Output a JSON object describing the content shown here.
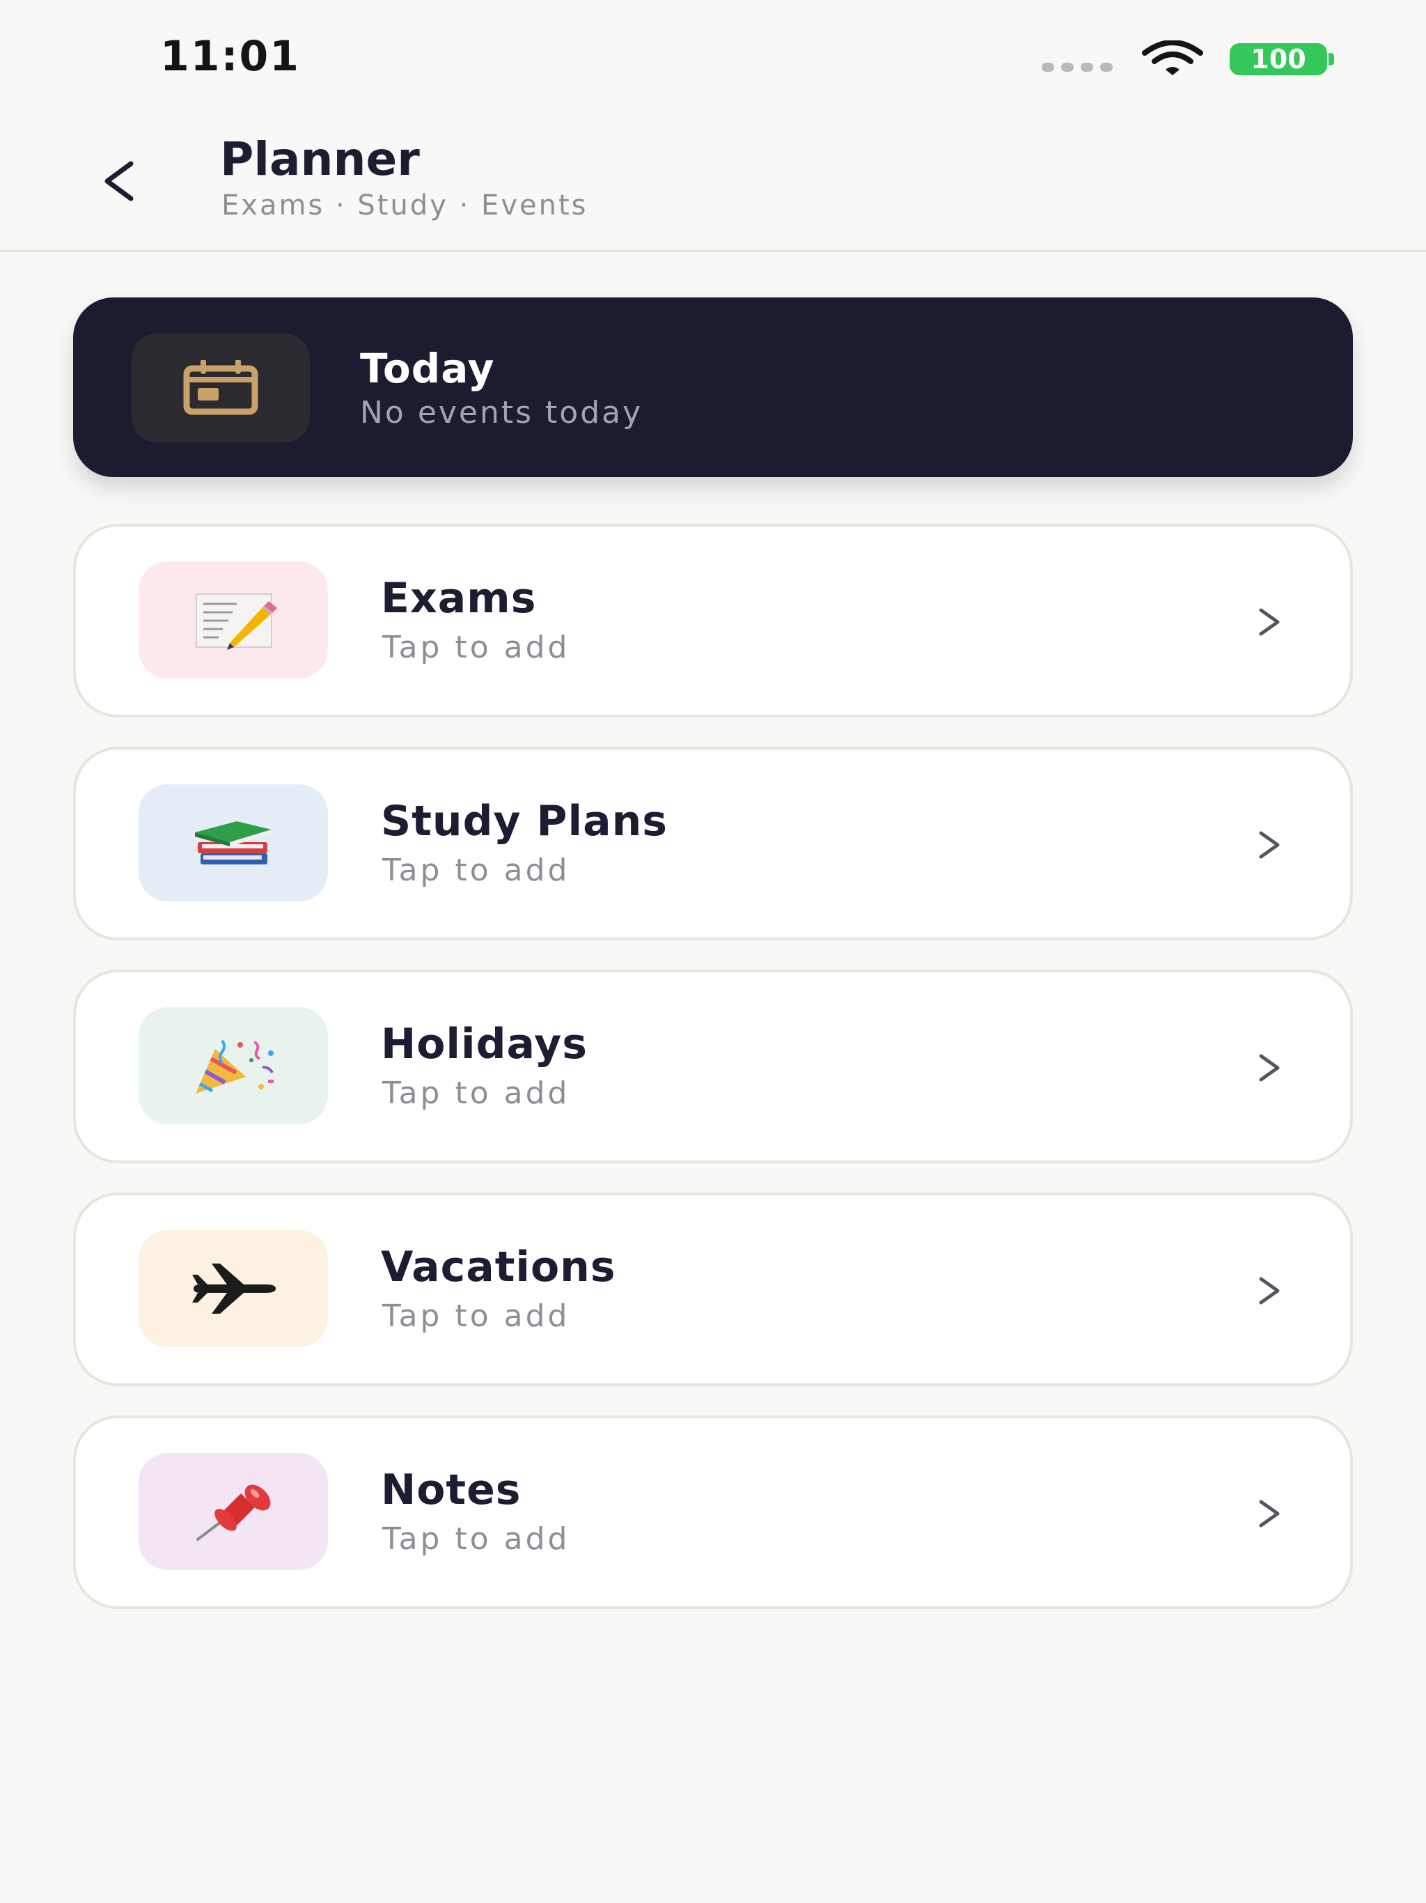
{
  "status_bar": {
    "time": "11:01",
    "battery": "100",
    "battery_color": "#34c759"
  },
  "header": {
    "title": "Planner",
    "subtitle": "Exams · Study · Events",
    "back_icon": "chevron-left-icon"
  },
  "today": {
    "title": "Today",
    "subtitle": "No events today",
    "icon": "calendar-icon",
    "background": "#1c1c30",
    "accent": "#c9a267"
  },
  "categories": [
    {
      "title": "Exams",
      "subtitle": "Tap to add",
      "icon": "memo-icon",
      "tile_color": "#fde9ec"
    },
    {
      "title": "Study Plans",
      "subtitle": "Tap to add",
      "icon": "books-icon",
      "tile_color": "#e4edf6"
    },
    {
      "title": "Holidays",
      "subtitle": "Tap to add",
      "icon": "party-popper-icon",
      "tile_color": "#e9f3ee"
    },
    {
      "title": "Vacations",
      "subtitle": "Tap to add",
      "icon": "airplane-icon",
      "tile_color": "#fdf1e1"
    },
    {
      "title": "Notes",
      "subtitle": "Tap to add",
      "icon": "pushpin-icon",
      "tile_color": "#f3e5f4"
    }
  ]
}
